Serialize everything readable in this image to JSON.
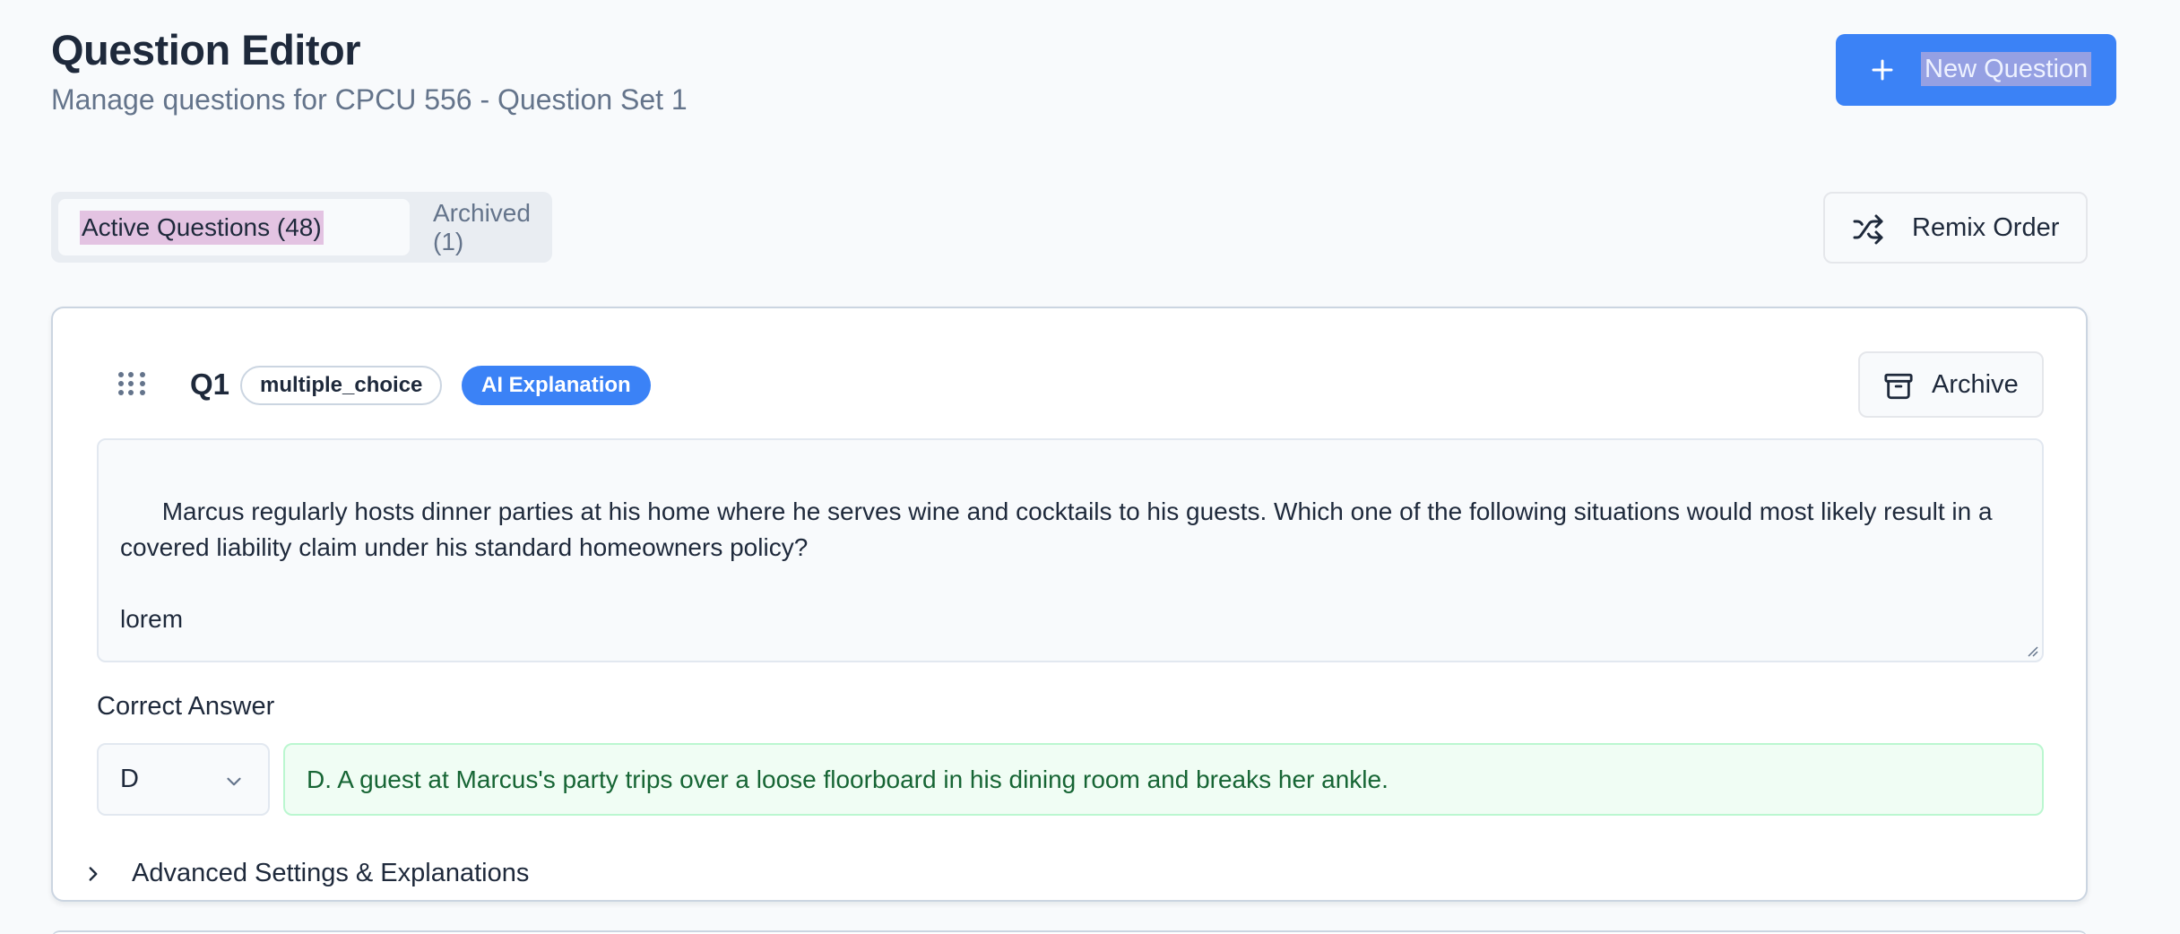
{
  "header": {
    "title": "Question Editor",
    "subtitle": "Manage questions for CPCU 556 - Question Set 1",
    "new_button_label": "New Question"
  },
  "tabs": [
    {
      "label": "Active Questions (48)",
      "active": true
    },
    {
      "label": "Archived (1)",
      "active": false
    }
  ],
  "toolbar": {
    "remix_label": "Remix Order"
  },
  "question": {
    "number": "Q1",
    "type_badge": "multiple_choice",
    "ai_badge": "AI Explanation",
    "archive_label": "Archive",
    "text": "Marcus regularly hosts dinner parties at his home where he serves wine and cocktails to his guests. Which one of the following situations would most likely result in a covered liability claim under his standard homeowners policy?\n\nlorem",
    "correct_answer_label": "Correct Answer",
    "correct_answer_value": "D",
    "correct_answer_text": "D. A guest at Marcus's party trips over a loose floorboard in his dining room and breaks her ankle.",
    "advanced_label": "Advanced Settings & Explanations"
  },
  "icons": {
    "new": "plus-icon",
    "remix": "shuffle-icon",
    "drag": "drag-handle-icon",
    "archive": "archive-icon",
    "select": "chevron-down-icon",
    "advanced": "chevron-right-icon"
  },
  "colors": {
    "primary": "#3b82f6",
    "answer_bg": "#f0fdf4",
    "answer_text": "#166534"
  }
}
